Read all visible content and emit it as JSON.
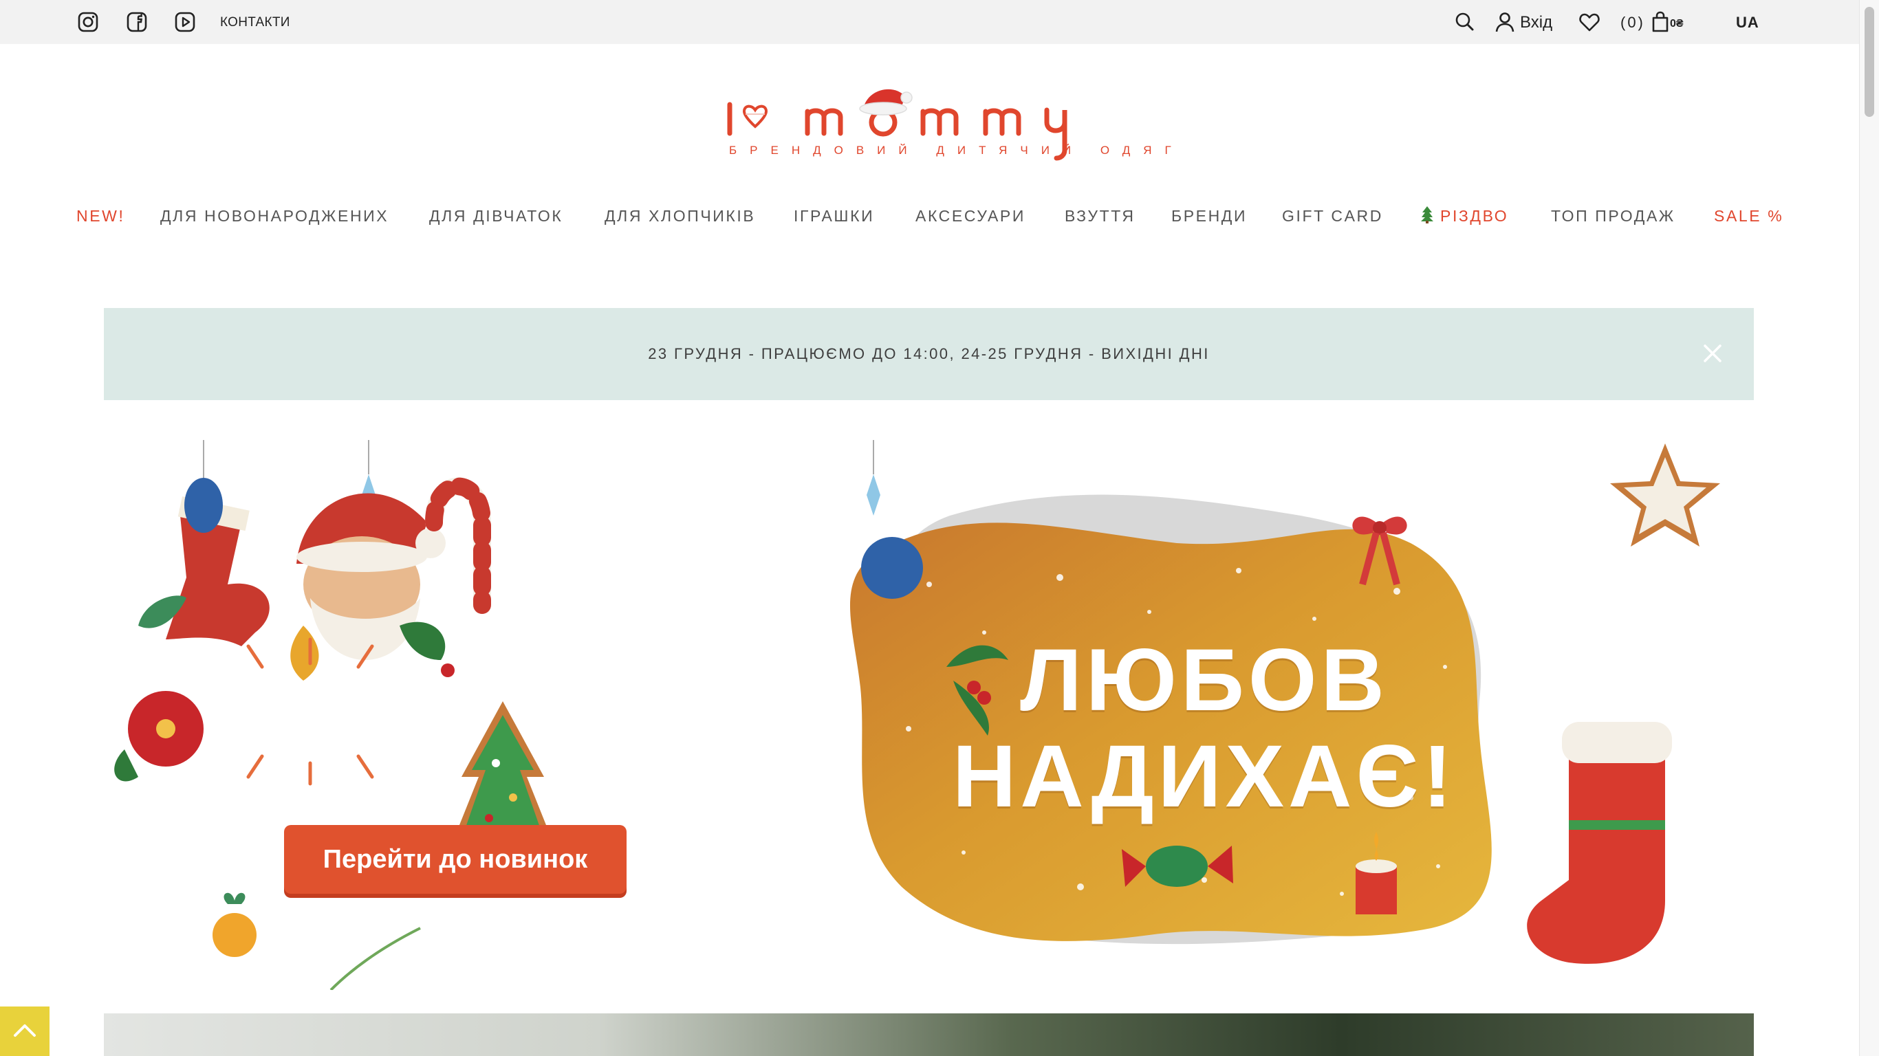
{
  "topbar": {
    "social_icons": [
      "instagram-icon",
      "facebook-icon",
      "youtube-icon"
    ],
    "contacts_label": "КОНТАКТИ",
    "login_label": "Вхід",
    "cart_count": "(0)",
    "cart_subtotal": "0₴",
    "language": "UA"
  },
  "logo": {
    "text": "I ♥ mommy",
    "tagline": "БРЕНДОВИЙ ДИТЯЧИЙ ОДЯГ"
  },
  "nav": {
    "items": [
      {
        "label": "NEW!",
        "highlight": true
      },
      {
        "label": "ДЛЯ НОВОНАРОДЖЕНИХ",
        "highlight": false
      },
      {
        "label": "ДЛЯ ДІВЧАТОК",
        "highlight": false
      },
      {
        "label": "ДЛЯ ХЛОПЧИКІВ",
        "highlight": false
      },
      {
        "label": "ІГРАШКИ",
        "highlight": false
      },
      {
        "label": "АКСЕСУАРИ",
        "highlight": false
      },
      {
        "label": "ВЗУТТЯ",
        "highlight": false
      },
      {
        "label": "БРЕНДИ",
        "highlight": false
      },
      {
        "label": "GIFT CARD",
        "highlight": false
      },
      {
        "label": "РІЗДВО",
        "highlight": true,
        "icon": "christmas-tree-icon"
      },
      {
        "label": "ТОП ПРОДАЖ",
        "highlight": false
      },
      {
        "label": "SALE %",
        "highlight": true
      }
    ]
  },
  "notice": {
    "text": "23 ГРУДНЯ - ПРАЦЮЄМО ДО 14:00, 24-25 ГРУДНЯ - ВИХІДНІ ДНІ"
  },
  "hero": {
    "cta_label": "Перейти до новинок",
    "headline_line1": "ЛЮБОВ",
    "headline_line2": "НАДИХАЄ!"
  },
  "colors": {
    "brand_red": "#e0462d",
    "topbar_bg": "#f2f2f2",
    "notice_bg": "#dbe9e6",
    "scroll_top_bg": "#e8d23b"
  }
}
